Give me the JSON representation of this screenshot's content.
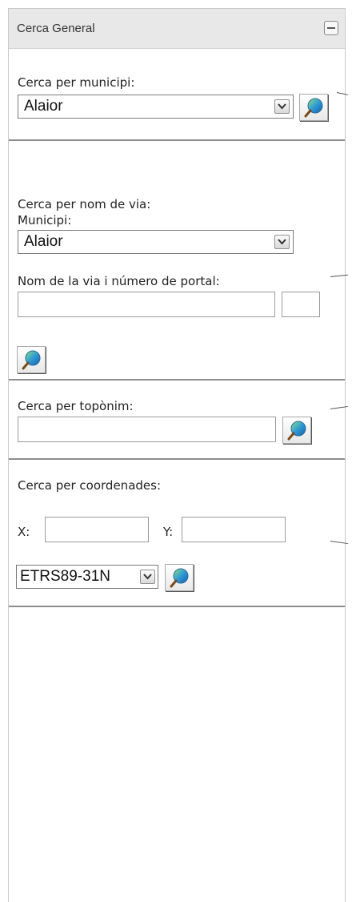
{
  "panel": {
    "title": "Cerca General"
  },
  "municipi_search": {
    "label": "Cerca per municipi:",
    "selected": "Alaior"
  },
  "street_search": {
    "label": "Cerca per nom de via:",
    "municipi_label": "Municipi:",
    "municipi_selected": "Alaior",
    "street_label": "Nom de la via i número de portal:",
    "street_value": "",
    "number_value": ""
  },
  "toponym_search": {
    "label": "Cerca per topònim:",
    "value": ""
  },
  "coord_search": {
    "label": "Cerca per coordenades:",
    "x_label": "X:",
    "y_label": "Y:",
    "x_value": "",
    "y_value": "",
    "crs_selected": "ETRS89-31N"
  },
  "icons": {
    "search": "search-globe-icon",
    "dropdown": "chevron-down-icon",
    "collapse": "minus-icon"
  }
}
